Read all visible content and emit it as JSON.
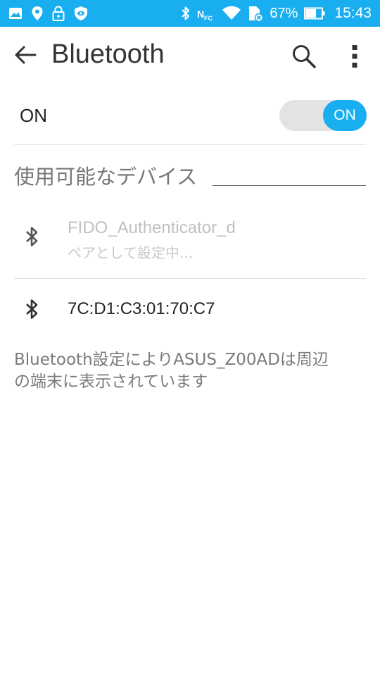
{
  "status_bar": {
    "battery_percent": "67%",
    "time": "15:43",
    "bg_color": "#18aef0",
    "left_icons": [
      "image-icon",
      "location-icon",
      "lock-icon",
      "shield-icon"
    ],
    "right_icons": [
      "bluetooth-icon",
      "nfc-icon",
      "wifi-icon",
      "sim-icon",
      "battery-icon"
    ]
  },
  "app_bar": {
    "title": "Bluetooth",
    "back_icon": "arrow-back-icon",
    "search_icon": "search-icon",
    "more_icon": "more-vert-icon"
  },
  "toggle": {
    "label": "ON",
    "switch_label": "ON",
    "state": true,
    "accent_color": "#18aef0"
  },
  "available_devices": {
    "header": "使用可能なデバイス",
    "items": [
      {
        "name": "FIDO_Authenticator_d",
        "status": "ペアとして設定中...",
        "icon": "bluetooth-icon"
      },
      {
        "name": "7C:D1:C3:01:70:C7",
        "icon": "bluetooth-icon"
      }
    ]
  },
  "info": {
    "text_line1": "Bluetooth設定によりASUS_Z00ADは周辺",
    "text_line2": "の端末に表示されています"
  }
}
